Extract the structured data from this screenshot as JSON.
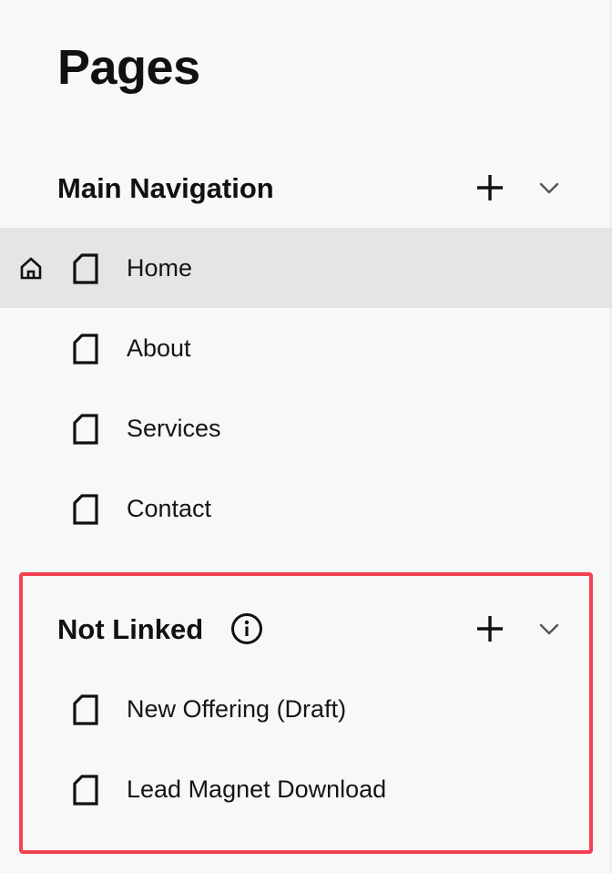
{
  "page_title": "Pages",
  "colors": {
    "background": "#f8f8f8",
    "selected_row": "#e5e5e5",
    "highlight_border": "#f24152",
    "text": "#111111"
  },
  "sections": {
    "main_navigation": {
      "title": "Main Navigation",
      "add_icon": "plus-icon",
      "collapse_icon": "chevron-down-icon",
      "items": [
        {
          "label": "Home",
          "icon": "page-icon",
          "is_homepage": true,
          "selected": true
        },
        {
          "label": "About",
          "icon": "page-icon"
        },
        {
          "label": "Services",
          "icon": "page-icon"
        },
        {
          "label": "Contact",
          "icon": "page-icon"
        }
      ]
    },
    "not_linked": {
      "title": "Not Linked",
      "info_icon": "info-icon",
      "add_icon": "plus-icon",
      "collapse_icon": "chevron-down-icon",
      "items": [
        {
          "label": "New Offering (Draft)",
          "icon": "page-icon"
        },
        {
          "label": "Lead Magnet Download",
          "icon": "page-icon"
        }
      ]
    }
  }
}
